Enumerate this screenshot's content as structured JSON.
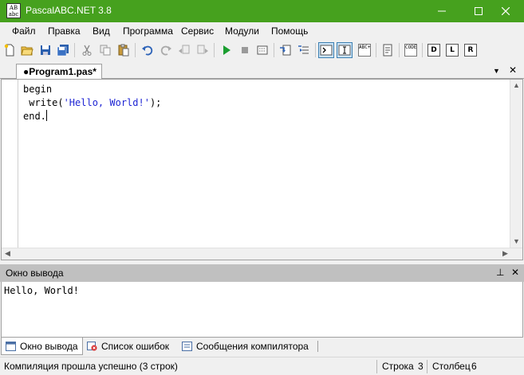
{
  "window": {
    "title": "PascalABC.NET 3.8",
    "app_icon_text": "AB\nabc",
    "min_glyph": "—",
    "max_glyph": "☐",
    "close_glyph": "✕"
  },
  "menu": [
    "Файл",
    "Правка",
    "Вид",
    "Программа",
    "Сервис",
    "Модули",
    "Помощь"
  ],
  "toolbar": {
    "icons": [
      "new-file-icon",
      "open-folder-icon",
      "save-icon",
      "save-all-icon",
      "cut-icon",
      "copy-icon",
      "paste-icon",
      "undo-icon",
      "redo-icon",
      "navigate-back-icon",
      "navigate-forward-icon",
      "run-icon",
      "stop-icon",
      "debug-icon",
      "step-into-icon",
      "step-over-icon",
      "output-window-icon",
      "input-window-icon",
      "abc-format-icon",
      "code-template-icon",
      "code-icon",
      "doc-d-icon",
      "doc-l-icon",
      "doc-r-icon"
    ],
    "labels": {
      "abc": "ABC+",
      "code": "CODE",
      "d": "D",
      "l": "L",
      "r": "R"
    }
  },
  "editor": {
    "tab_label": "●Program1.pas*",
    "dropdown_glyph": "▼",
    "close_glyph": "✕",
    "code_lines": {
      "l1": "begin",
      "l2_pre": " write(",
      "l2_str": "'Hello, World!'",
      "l2_post": ");",
      "l3": "end."
    }
  },
  "output": {
    "title": "Окно вывода",
    "pin_glyph": "⊥",
    "close_glyph": "✕",
    "text": "Hello, World!"
  },
  "bottom_tabs": [
    {
      "label": "Окно вывода",
      "active": true
    },
    {
      "label": "Список ошибок",
      "active": false
    },
    {
      "label": "Сообщения компилятора",
      "active": false
    }
  ],
  "status": {
    "message": "Компиляция прошла успешно (3 строк)",
    "line_label": "Строка",
    "line_value": "3",
    "col_label": "Столбец",
    "col_value": "6"
  },
  "colors": {
    "titlebar": "#46a11e",
    "string_literal": "#1f26d4",
    "run_green": "#1b9e30"
  }
}
